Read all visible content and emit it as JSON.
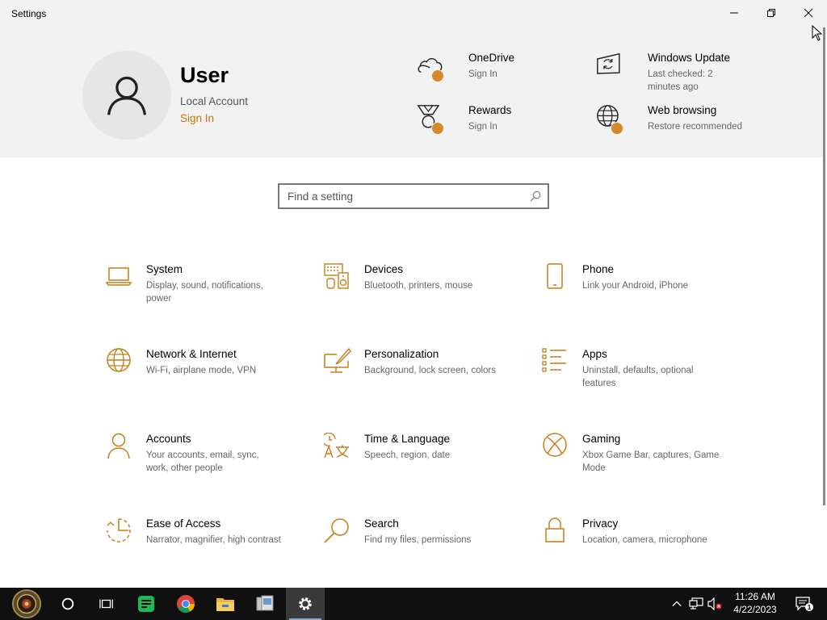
{
  "window": {
    "title": "Settings"
  },
  "header": {
    "user": {
      "name": "User",
      "account_type": "Local Account",
      "sign_in": "Sign In"
    },
    "quick_items": [
      {
        "title": "OneDrive",
        "subtitle": "Sign In",
        "icon": "onedrive-cloud-icon"
      },
      {
        "title": "Windows Update",
        "subtitle": "Last checked: 2 minutes ago",
        "icon": "windows-update-icon"
      },
      {
        "title": "Rewards",
        "subtitle": "Sign In",
        "icon": "rewards-medal-icon"
      },
      {
        "title": "Web browsing",
        "subtitle": "Restore recommended",
        "icon": "globe-icon"
      }
    ]
  },
  "search": {
    "placeholder": "Find a setting"
  },
  "categories": [
    {
      "name": "System",
      "desc": "Display, sound, notifications, power",
      "icon": "laptop-icon"
    },
    {
      "name": "Devices",
      "desc": "Bluetooth, printers, mouse",
      "icon": "devices-icon"
    },
    {
      "name": "Phone",
      "desc": "Link your Android, iPhone",
      "icon": "phone-icon"
    },
    {
      "name": "Network & Internet",
      "desc": "Wi-Fi, airplane mode, VPN",
      "icon": "globe-icon"
    },
    {
      "name": "Personalization",
      "desc": "Background, lock screen, colors",
      "icon": "personalization-icon"
    },
    {
      "name": "Apps",
      "desc": "Uninstall, defaults, optional features",
      "icon": "apps-list-icon"
    },
    {
      "name": "Accounts",
      "desc": "Your accounts, email, sync, work, other people",
      "icon": "person-icon"
    },
    {
      "name": "Time & Language",
      "desc": "Speech, region, date",
      "icon": "time-language-icon"
    },
    {
      "name": "Gaming",
      "desc": "Xbox Game Bar, captures, Game Mode",
      "icon": "xbox-icon"
    },
    {
      "name": "Ease of Access",
      "desc": "Narrator, magnifier, high contrast",
      "icon": "ease-of-access-icon"
    },
    {
      "name": "Search",
      "desc": "Find my files, permissions",
      "icon": "magnifier-icon"
    },
    {
      "name": "Privacy",
      "desc": "Location, camera, microphone",
      "icon": "lock-icon"
    }
  ],
  "taskbar": {
    "clock": {
      "time": "11:26 AM",
      "date": "4/22/2023"
    },
    "notification_count": "1"
  },
  "colors": {
    "accent": "#c27700",
    "icon": "#c47f1b",
    "header_bg": "#f2f2f2",
    "taskbar_bg": "#101010"
  }
}
